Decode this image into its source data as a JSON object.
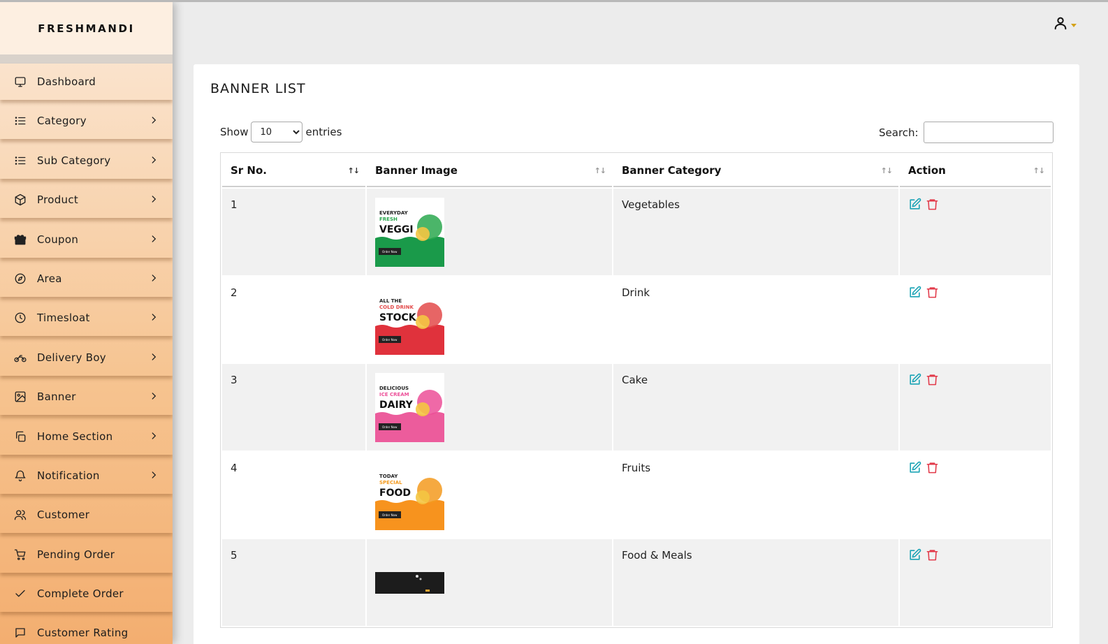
{
  "app": {
    "brand": "FRESHMANDI"
  },
  "sidebar": {
    "items": [
      {
        "label": "Dashboard",
        "icon": "monitor-icon",
        "has_submenu": false
      },
      {
        "label": "Category",
        "icon": "list-icon",
        "has_submenu": true
      },
      {
        "label": "Sub Category",
        "icon": "list-icon",
        "has_submenu": true
      },
      {
        "label": "Product",
        "icon": "box-icon",
        "has_submenu": true
      },
      {
        "label": "Coupon",
        "icon": "gift-icon",
        "has_submenu": true
      },
      {
        "label": "Area",
        "icon": "compass-icon",
        "has_submenu": true
      },
      {
        "label": "Timesloat",
        "icon": "clock-icon",
        "has_submenu": true
      },
      {
        "label": "Delivery Boy",
        "icon": "motorcycle-icon",
        "has_submenu": true
      },
      {
        "label": "Banner",
        "icon": "image-icon",
        "has_submenu": true
      },
      {
        "label": "Home Section",
        "icon": "copy-icon",
        "has_submenu": true
      },
      {
        "label": "Notification",
        "icon": "bell-icon",
        "has_submenu": true
      },
      {
        "label": "Customer",
        "icon": "users-icon",
        "has_submenu": false
      },
      {
        "label": "Pending Order",
        "icon": "cart-icon",
        "has_submenu": false
      },
      {
        "label": "Complete Order",
        "icon": "check-icon",
        "has_submenu": false
      },
      {
        "label": "Customer Rating",
        "icon": "message-icon",
        "has_submenu": false
      }
    ]
  },
  "main": {
    "title": "BANNER LIST",
    "length": {
      "show_label": "Show",
      "selected": "10",
      "entries_label": "entries"
    },
    "search": {
      "label": "Search:",
      "value": ""
    },
    "table": {
      "columns": [
        "Sr No.",
        "Banner Image",
        "Banner Category",
        "Action"
      ],
      "rows": [
        {
          "sr": "1",
          "banner_image": {
            "line1": "EVERYDAY",
            "line2": "FRESH",
            "line3": "VEGGI",
            "button": "Order Now",
            "bg": "#1a9a4a",
            "accent": "#2ba84f"
          },
          "category": "Vegetables"
        },
        {
          "sr": "2",
          "banner_image": {
            "line1": "ALL THE",
            "line2": "COLD DRINK",
            "line3": "STOCK",
            "button": "Order Now",
            "bg": "#e0323c",
            "accent": "#e34a4a"
          },
          "category": "Drink"
        },
        {
          "sr": "3",
          "banner_image": {
            "line1": "DELICIOUS",
            "line2": "ICE CREAM",
            "line3": "DAIRY",
            "button": "Order Now",
            "bg": "#ec5c9c",
            "accent": "#ec4f98"
          },
          "category": "Cake"
        },
        {
          "sr": "4",
          "banner_image": {
            "line1": "TODAY",
            "line2": "SPECIAL",
            "line3": "FOOD",
            "button": "Order Now",
            "bg": "#f7931e",
            "accent": "#f39a1f"
          },
          "category": "Fruits"
        },
        {
          "sr": "5",
          "banner_image": {
            "line1": "",
            "line2": "",
            "line3": "",
            "button": "",
            "bg": "#1c1c1c",
            "accent": "#1c1c1c"
          },
          "category": "Food & Meals"
        }
      ]
    }
  },
  "colors": {
    "edit": "#1aa3b5",
    "delete": "#e23a4a",
    "user_caret": "#d4a21a"
  }
}
